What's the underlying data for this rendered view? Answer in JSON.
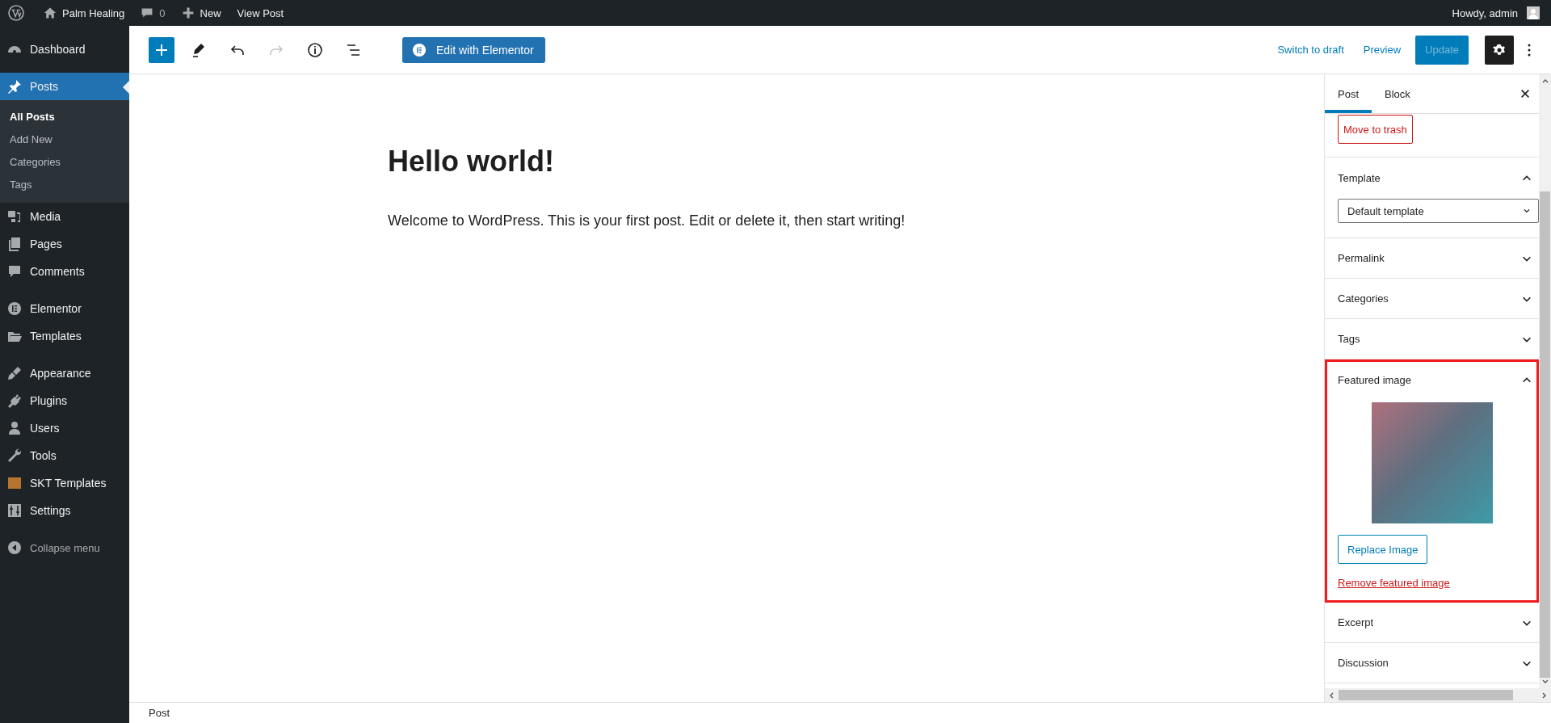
{
  "admin_bar": {
    "site_name": "Palm Healing",
    "comments_count": "0",
    "new_label": "New",
    "view_label": "View Post",
    "greeting": "Howdy, admin"
  },
  "sidebar": {
    "groups": [
      [
        {
          "label": "Dashboard",
          "selected": false
        }
      ],
      [
        {
          "label": "Posts",
          "selected": true,
          "children": [
            {
              "label": "All Posts",
              "selected": true
            },
            {
              "label": "Add New",
              "selected": false
            },
            {
              "label": "Categories",
              "selected": false
            },
            {
              "label": "Tags",
              "selected": false
            }
          ]
        },
        {
          "label": "Media",
          "selected": false
        },
        {
          "label": "Pages",
          "selected": false
        },
        {
          "label": "Comments",
          "selected": false
        }
      ],
      [
        {
          "label": "Elementor",
          "selected": false
        },
        {
          "label": "Templates",
          "selected": false
        }
      ],
      [
        {
          "label": "Appearance",
          "selected": false
        },
        {
          "label": "Plugins",
          "selected": false
        },
        {
          "label": "Users",
          "selected": false
        },
        {
          "label": "Tools",
          "selected": false
        },
        {
          "label": "SKT Templates",
          "selected": false
        },
        {
          "label": "Settings",
          "selected": false
        }
      ]
    ],
    "collapse_label": "Collapse menu"
  },
  "toolbar": {
    "tools": [
      {
        "disabled": false
      },
      {
        "disabled": false
      },
      {
        "disabled": false
      },
      {
        "disabled": true
      },
      {
        "disabled": false
      },
      {
        "disabled": false
      }
    ],
    "elementor_button": "Edit with Elementor",
    "switch_to_draft": "Switch to draft",
    "preview": "Preview",
    "update": {
      "label": "Update",
      "disabled": true
    },
    "settings_pressed": true
  },
  "document": {
    "title": "Hello world!",
    "paragraph": "Welcome to WordPress. This is your first post. Edit or delete it, then start writing!"
  },
  "settings_panel": {
    "tabs": [
      {
        "label": "Post",
        "selected": true
      },
      {
        "label": "Block",
        "selected": false
      }
    ],
    "trash_button": "Move to trash",
    "sections": [
      {
        "kind": "select",
        "title": "Template",
        "expanded": true,
        "highlighted": false,
        "value": "Default template"
      },
      {
        "kind": "plain",
        "title": "Permalink",
        "expanded": false,
        "highlighted": false
      },
      {
        "kind": "plain",
        "title": "Categories",
        "expanded": false,
        "highlighted": false
      },
      {
        "kind": "plain",
        "title": "Tags",
        "expanded": false,
        "highlighted": false
      },
      {
        "kind": "image",
        "title": "Featured image",
        "expanded": true,
        "highlighted": true,
        "replace_label": "Replace Image",
        "remove_label": "Remove featured image"
      },
      {
        "kind": "plain",
        "title": "Excerpt",
        "expanded": false,
        "highlighted": false
      },
      {
        "kind": "plain",
        "title": "Discussion",
        "expanded": false,
        "highlighted": false
      }
    ]
  },
  "footer": {
    "breadcrumb": "Post"
  }
}
